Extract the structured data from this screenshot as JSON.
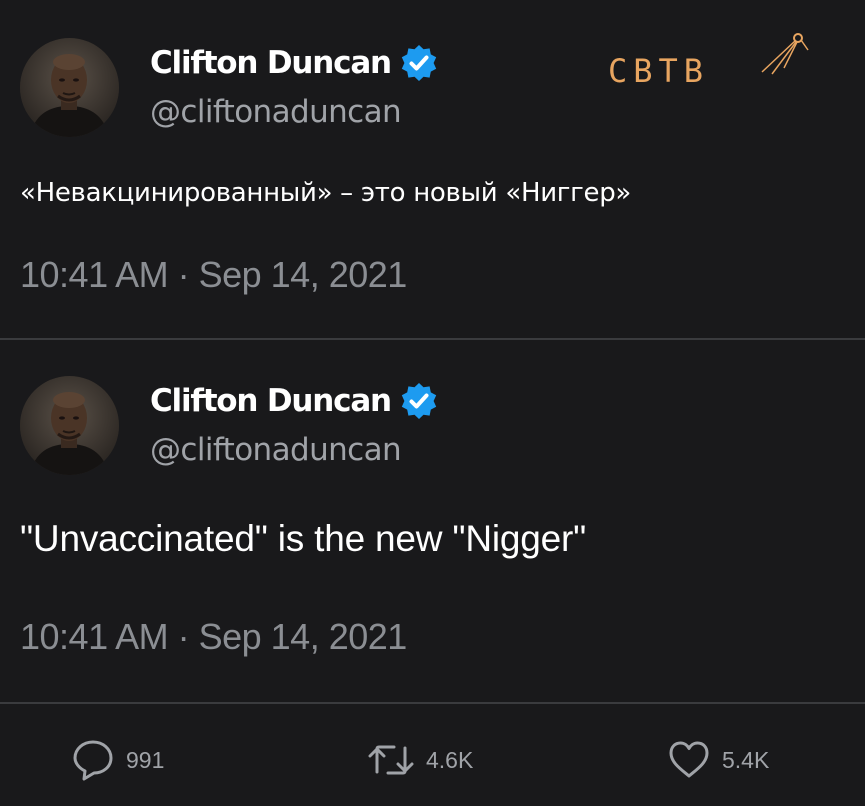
{
  "colors": {
    "background": "#19191b",
    "text": "#ffffff",
    "secondary_text": "#a0a3a8",
    "verified_blue": "#1d9bf0",
    "logo_orange": "#e8a560",
    "divider": "#3a3b3e"
  },
  "watermark": {
    "text": "СВТВ",
    "icon": "satellite-icon"
  },
  "tweets": [
    {
      "author": {
        "name": "Clifton Duncan",
        "handle": "@cliftonaduncan",
        "verified_icon": "verified-badge-icon"
      },
      "text": "«Невакцинированный» – это новый «Ниггер»",
      "timestamp": "10:41 AM · Sep 14, 2021"
    },
    {
      "author": {
        "name": "Clifton Duncan",
        "handle": "@cliftonaduncan",
        "verified_icon": "verified-badge-icon"
      },
      "text": "\"Unvaccinated\" is the new \"Nigger\"",
      "timestamp": "10:41 AM · Sep 14, 2021"
    }
  ],
  "actions": {
    "reply": {
      "icon": "reply-bubble-icon",
      "count": "991"
    },
    "retweet": {
      "icon": "retweet-icon",
      "count": "4.6K"
    },
    "like": {
      "icon": "heart-icon",
      "count": "5.4K"
    }
  }
}
